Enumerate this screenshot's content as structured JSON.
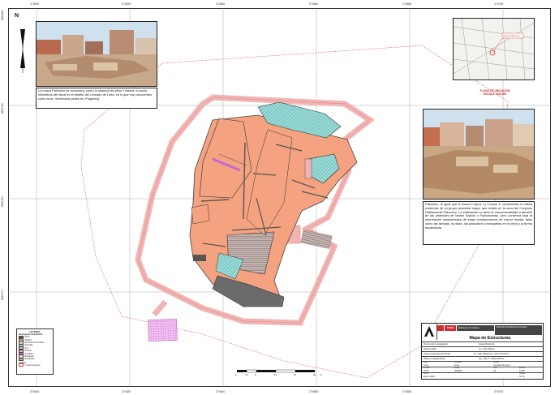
{
  "grid_labels": {
    "top": [
      "274600",
      "274620",
      "274640",
      "274660",
      "274680",
      "274700"
    ],
    "bottom": [
      "274600",
      "274620",
      "274640",
      "274660",
      "274680",
      "274700"
    ],
    "left": [
      "8661740",
      "8661720",
      "8661700",
      "8661680"
    ],
    "right": [
      "8661740",
      "8661720",
      "8661700",
      "8661680"
    ]
  },
  "photo_top_left": {
    "caption": "La huaca Palomino se encuentra, como la mayoría de sitios Ychsma, a pocos kilómetros del litoral en el distrito del Cercado de Lima, en lo que hoy conocemos como la Av. Venezuela (antes Av. Progreso)."
  },
  "photo_right": {
    "caption": "Palomino, al igual que la huaca Corpus I y Corpus II, representan la última evidencia de un grupo piramidal mayor que existió en la zona del Conjunto Habitacional Palomino. La edificación no tiene la monumentalidad a tamaño de las pirámides de Mateo Salado o Pachacamac, pero conserva toda la información característica de estas construcciones en menor escala, tales como las rampas, la plaza, las pasadizos o banquetas en la cima y la forma escalonada."
  },
  "location_map": {
    "title": "PLANO DE UBICACIÓN",
    "scale": "ESCALA: 1/20,000",
    "label": "Huaca Palomino"
  },
  "legend": {
    "title": "LEYENDA",
    "subtitle": "Descripción Estructural",
    "items": [
      {
        "label": "Muro",
        "color": "#555555"
      },
      {
        "label": "Relleno",
        "color": "#f4a27f"
      },
      {
        "label": "Estructura de Adobe",
        "color": "#e8c9b2"
      },
      {
        "label": "Enlucido",
        "color": "#9adbd8"
      },
      {
        "label": "Piso",
        "color": "#d9a8d9"
      },
      {
        "label": "Rampa",
        "color": "#f2b0b0"
      },
      {
        "label": "Pasadizo",
        "color": "#c06ad0"
      },
      {
        "label": "Banqueta",
        "color": "#ffd0d0"
      },
      {
        "label": "Escalinata",
        "color": "#aaaaaa"
      }
    ],
    "limits_title": "Límites",
    "limit_item": "Límite de Huaca"
  },
  "title_block": {
    "ministry": "Ministerio de Cultura",
    "peru": "PERÚ",
    "direction": "Dirección de Patrimonio Cultural",
    "title": "Mapa de Estructuras",
    "rows": [
      {
        "label": "Documento Investigación",
        "value": "Huaca Palomino"
      },
      {
        "label": "Responsable",
        "value": "Lic. Julio Abanto"
      },
      {
        "label": "Tarea (Arqueólogo/Cultural)",
        "value": "Lic. Aldo Watanave / José Orrantere"
      },
      {
        "label": "Dibujo y Diagramación",
        "value": "Ing. Julio O. Abanto Bravo"
      }
    ],
    "details": [
      {
        "label": "Zona",
        "value": "Lima"
      },
      {
        "label": "Provincia",
        "value": "Lima"
      },
      {
        "label": "Distrito",
        "value": "Cercado de Lima"
      },
      {
        "label": "Sistema",
        "value": "UTM"
      },
      {
        "label": "Datum",
        "value": "WGS84"
      },
      {
        "label": "Zona",
        "value": "18"
      },
      {
        "label": "Escala",
        "value": "1/250"
      },
      {
        "label": "Fecha",
        "value": "Enero 2016"
      },
      {
        "label": "Lámina",
        "value": "Nº 01"
      }
    ]
  },
  "scalebar": {
    "labels": [
      "0",
      "2.5",
      "5",
      "10",
      "15",
      "20"
    ],
    "unit": "m"
  },
  "north": {
    "label": "N"
  },
  "colors": {
    "boundary": "#f2b3b3",
    "relleno": "#f4a27f",
    "enlucido": "#9adbd8",
    "muro": "#555555",
    "piso": "#d9a8d9",
    "pasadizo": "#c06ad0",
    "accent_red": "#d32f2f"
  }
}
